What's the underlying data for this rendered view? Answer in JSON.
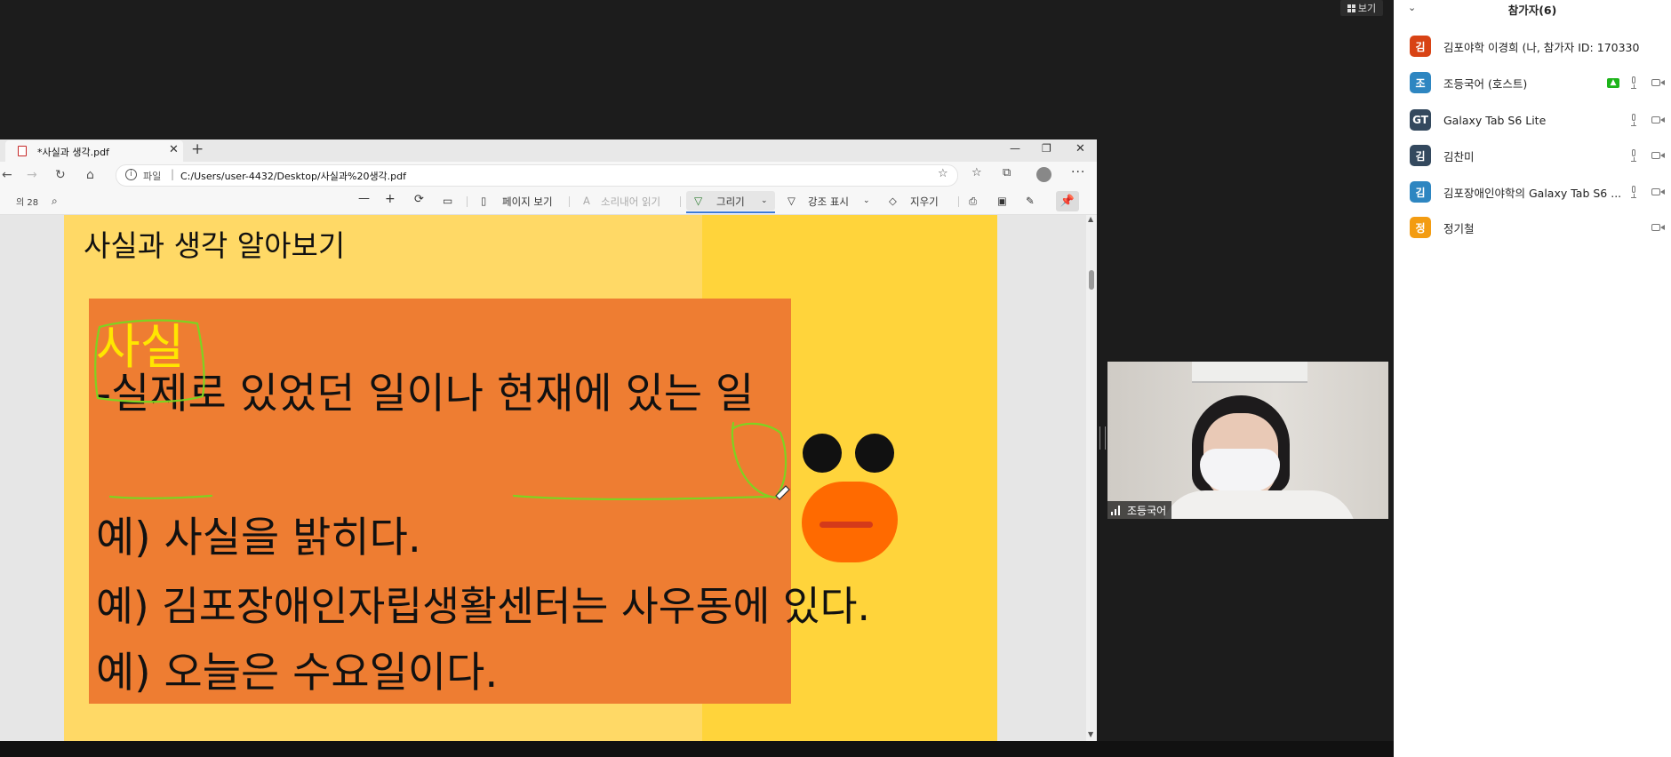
{
  "topbar": {
    "view_label": "보기"
  },
  "participants": {
    "title": "참가자(6)",
    "items": [
      {
        "initial": "김",
        "color": "#d84315",
        "name": "김포야학 이경희 (나, 참가자 ID: 170330)",
        "mic": false,
        "video": false,
        "share": false
      },
      {
        "initial": "조",
        "color": "#2e86c1",
        "name": "조등국어 (호스트)",
        "mic": true,
        "video": true,
        "share": true
      },
      {
        "initial": "GT",
        "color": "#34495e",
        "name": "Galaxy Tab S6 Lite",
        "mic": true,
        "video": true,
        "share": false
      },
      {
        "initial": "김",
        "color": "#34495e",
        "name": "김찬미",
        "mic": true,
        "video": true,
        "share": false
      },
      {
        "initial": "김",
        "color": "#2e86c1",
        "name": "김포장애인야학의 Galaxy Tab S6 ...",
        "mic": true,
        "video": true,
        "share": false
      },
      {
        "initial": "정",
        "color": "#f39c12",
        "name": "정기철",
        "mic": false,
        "video": true,
        "share": false
      }
    ]
  },
  "browser": {
    "tab_title": "*사실과 생각.pdf",
    "url_scheme": "파일",
    "url": "C:/Users/user-4432/Desktop/사실과%20생각.pdf"
  },
  "pdf_toolbar": {
    "page_count": "의 28",
    "page_view": "페이지 보기",
    "read_aloud": "소리내어 읽기",
    "draw": "그리기",
    "highlight": "강조 표시",
    "erase": "지우기"
  },
  "slide": {
    "title": "사실과 생각 알아보기",
    "heading": "사실",
    "definition": "-실제로 있었던 일이나 현재에 있는 일",
    "examples": [
      "예) 사실을 밝히다.",
      "예) 김포장애인자립생활센터는 사우동에 있다.",
      "예) 오늘은 수요일이다."
    ]
  },
  "video": {
    "name": "조등국어"
  }
}
